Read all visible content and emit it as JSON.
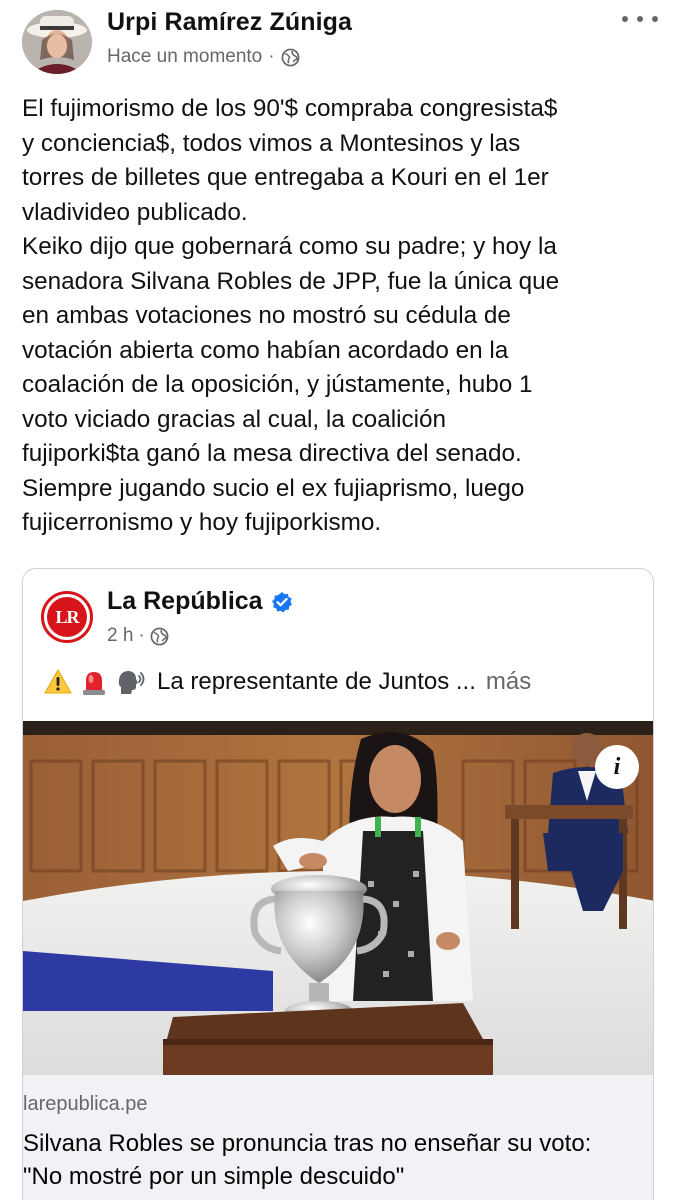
{
  "post": {
    "author": "Urpi Ramírez Zúniga",
    "time": "Hace un momento",
    "separator": "·",
    "audience_icon": "globe-icon",
    "more_icon": "more-horizontal-icon",
    "text_lines": [
      "El fujimorismo de los 90'$ compraba congresista$",
      "y conciencia$, todos vimos a Montesinos y las",
      "torres de billetes que entregaba a Kouri en el 1er",
      "vladivideo publicado.",
      "Keiko dijo que gobernará como su padre; y hoy la",
      "senadora Silvana Robles de JPP, fue la única que",
      "en ambas votaciones no mostró su cédula de",
      "votación abierta como habían acordado en la",
      "coalación de la oposición, y jústamente, hubo 1",
      "voto viciado gracias al cual, la coalición",
      "fujiporki$ta ganó la mesa directiva del senado.",
      "Siempre jugando sucio el ex fujiaprismo, luego",
      "fujicerronismo y hoy fujiporkismo."
    ]
  },
  "shared": {
    "page_name": "La República",
    "logo_text": "LR",
    "verified_icon": "verified-badge-icon",
    "time": "2 h",
    "separator": "·",
    "audience_icon": "globe-icon",
    "caption_emojis": [
      "warning-icon",
      "siren-icon",
      "speaking-head-icon"
    ],
    "caption": "La representante de Juntos ...",
    "more": "más",
    "info_icon": "info-icon",
    "info_label": "i",
    "link_domain": "larepublica.pe",
    "link_title_lines": [
      "Silvana Robles se pronuncia tras no enseñar su voto:",
      "\"No mostré por un simple descuido\""
    ]
  },
  "colors": {
    "text": "#050505",
    "secondary_text": "#65676b",
    "verified_blue": "#1877f2",
    "lr_red": "#d7141a",
    "link_footer_bg": "#f0f2f5",
    "card_border": "#ced0d4"
  }
}
